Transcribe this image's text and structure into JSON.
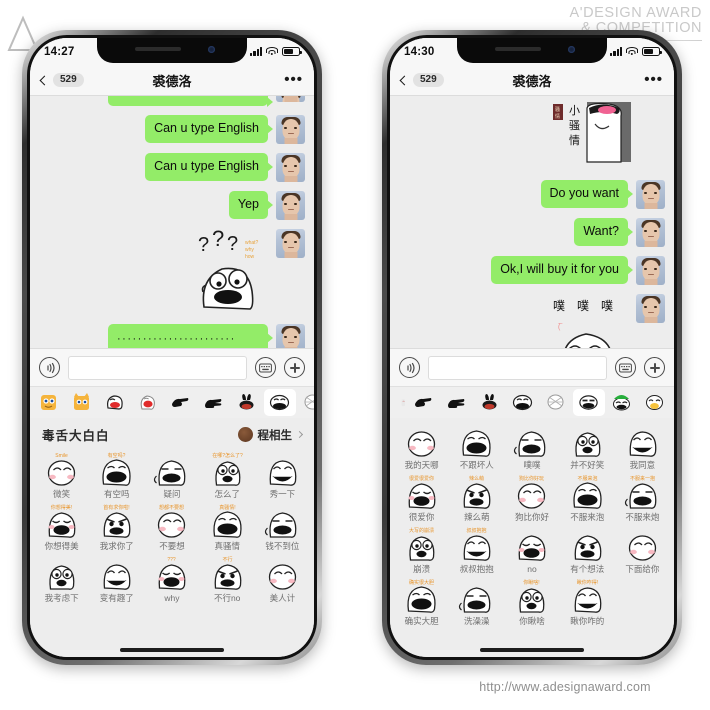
{
  "branding": {
    "award_line1": "A'DESIGN AWARD",
    "award_line2": "& COMPETITION",
    "url": "http://www.adesignaward.com"
  },
  "phones": [
    {
      "id": "left-phone",
      "status": {
        "time": "14:27",
        "signal_bars": 4,
        "wifi": "wifi-icon",
        "battery": "battery-icon"
      },
      "nav": {
        "back_icon": "chevron-left-icon",
        "back_badge": "529",
        "title": "裘德洛",
        "more_icon": "more-dots-icon"
      },
      "messages": [
        {
          "type": "text",
          "text": "",
          "cut": true
        },
        {
          "type": "text",
          "text": "Can u type English"
        },
        {
          "type": "text",
          "text": "Can u type English"
        },
        {
          "type": "text",
          "text": "Yep"
        },
        {
          "type": "sticker",
          "art": "question-shock-sticker",
          "text": "???"
        },
        {
          "type": "text",
          "text": "·······················",
          "dots": true
        }
      ],
      "input": {
        "voice_icon": "voice-icon",
        "value": "",
        "placeholder": "",
        "keyboard_icon": "keyboard-icon",
        "plus_icon": "plus-icon"
      },
      "tabs": [
        {
          "icon": "cat-emoji-tab",
          "active": false
        },
        {
          "icon": "cat-emoji-tab-2",
          "active": false
        },
        {
          "icon": "open-mouth-tab",
          "active": false
        },
        {
          "icon": "red-mouth-tab",
          "active": false
        },
        {
          "icon": "pointing-hand-tab",
          "active": false
        },
        {
          "icon": "pointing-hand-tab-2",
          "active": false
        },
        {
          "icon": "bunny-tab",
          "active": false
        },
        {
          "icon": "grin-face-tab",
          "active": true
        },
        {
          "icon": "scribble-face-tab",
          "active": false
        }
      ],
      "panel": {
        "title": "毒舌大白白",
        "author": "程相生",
        "author_avatar": "author-avatar",
        "chevron": "chevron-right-icon"
      },
      "stickers": [
        {
          "label": "微笑",
          "art": "smile-sticker",
          "caption": "Smile"
        },
        {
          "label": "有空吗",
          "art": "free-sticker",
          "caption": "有空吗?"
        },
        {
          "label": "疑问",
          "art": "doubt-sticker",
          "caption": ""
        },
        {
          "label": "怎么了",
          "art": "whatsup-sticker",
          "caption": "在哪?怎么了?"
        },
        {
          "label": "秀一下",
          "art": "showoff-sticker",
          "caption": ""
        },
        {
          "label": "你想得美",
          "art": "dream-on-sticker",
          "caption": "你想得美!"
        },
        {
          "label": "我求你了",
          "art": "beg-sticker",
          "caption": "首有求你啦!"
        },
        {
          "label": "不要想",
          "art": "dont-think-sticker",
          "caption": "想都不要想"
        },
        {
          "label": "真骚情",
          "art": "flirty-sticker",
          "caption": "真骚情!"
        },
        {
          "label": "钱不到位",
          "art": "no-money-sticker",
          "caption": ""
        },
        {
          "label": "我考虑下",
          "art": "consider-sticker",
          "caption": ""
        },
        {
          "label": "变有趣了",
          "art": "fun-sticker",
          "caption": ""
        },
        {
          "label": "why",
          "art": "why-sticker",
          "caption": "???"
        },
        {
          "label": "不行no",
          "art": "no-way-sticker",
          "caption": "不行"
        },
        {
          "label": "美人计",
          "art": "honeytrap-sticker",
          "caption": ""
        }
      ]
    },
    {
      "id": "right-phone",
      "status": {
        "time": "14:30",
        "signal_bars": 4,
        "wifi": "wifi-icon",
        "battery": "battery-icon"
      },
      "nav": {
        "back_icon": "chevron-left-icon",
        "back_badge": "529",
        "title": "裘德洛",
        "more_icon": "more-dots-icon"
      },
      "messages": [
        {
          "type": "sticker",
          "art": "flirty-girl-sticker",
          "text": "小骚情"
        },
        {
          "type": "text",
          "text": "Do you want"
        },
        {
          "type": "text",
          "text": "Want?"
        },
        {
          "type": "text",
          "text": "Ok,I will buy it for you"
        },
        {
          "type": "sticker",
          "art": "giggle-sticker",
          "text": "噗 噗 噗"
        }
      ],
      "input": {
        "voice_icon": "voice-icon",
        "value": "",
        "placeholder": "",
        "keyboard_icon": "keyboard-icon",
        "plus_icon": "plus-icon"
      },
      "tabs": [
        {
          "icon": "partial-tab",
          "active": false
        },
        {
          "icon": "pointing-hand-tab",
          "active": false
        },
        {
          "icon": "pointing-hand-tab-2",
          "active": false
        },
        {
          "icon": "bunny-tab",
          "active": false
        },
        {
          "icon": "grin-face-tab",
          "active": false
        },
        {
          "icon": "scribble-face-tab",
          "active": false
        },
        {
          "icon": "smirk-face-tab",
          "active": true
        },
        {
          "icon": "green-hat-tab",
          "active": false
        },
        {
          "icon": "duck-face-tab",
          "active": false
        }
      ],
      "panel": {
        "title": "",
        "author": "",
        "author_avatar": "",
        "chevron": ""
      },
      "stickers": [
        {
          "label": "我的天哪",
          "art": "omg-sticker",
          "caption": ""
        },
        {
          "label": "不跟坏人",
          "art": "no-badguy-sticker",
          "caption": ""
        },
        {
          "label": "噗噗",
          "art": "puff-sticker",
          "caption": ""
        },
        {
          "label": "并不好笑",
          "art": "notfunny-sticker",
          "caption": ""
        },
        {
          "label": "我同意",
          "art": "agree-sticker",
          "caption": ""
        },
        {
          "label": "很爱你",
          "art": "loveyou-sticker",
          "caption": "很爱很爱你"
        },
        {
          "label": "辣么萌",
          "art": "socute-sticker",
          "caption": "辣么萌"
        },
        {
          "label": "狗比你好",
          "art": "dogbetter-sticker",
          "caption": "狗比你好玩"
        },
        {
          "label": "不服来泡",
          "art": "comepool-sticker",
          "caption": "不服来泡"
        },
        {
          "label": "不服来炮",
          "art": "comefight-sticker",
          "caption": "不服来一抱"
        },
        {
          "label": "崩溃",
          "art": "breakdown-sticker",
          "caption": "大写的崩溃"
        },
        {
          "label": "叔叔抱抱",
          "art": "uncle-hug-sticker",
          "caption": "叔叔抱抱"
        },
        {
          "label": "no",
          "art": "no-sticker",
          "caption": ""
        },
        {
          "label": "有个想法",
          "art": "idea-sticker",
          "caption": ""
        },
        {
          "label": "下面给你",
          "art": "below-sticker",
          "caption": ""
        },
        {
          "label": "确实大胆",
          "art": "bold-sticker",
          "caption": "确实很大胆"
        },
        {
          "label": "洗澡澡",
          "art": "bath-sticker",
          "caption": ""
        },
        {
          "label": "你瞅啥",
          "art": "lookingat-sticker",
          "caption": "你瞅啥!"
        },
        {
          "label": "瞅你咋的",
          "art": "sowhat-sticker",
          "caption": "瞅你咋得!"
        }
      ]
    }
  ]
}
